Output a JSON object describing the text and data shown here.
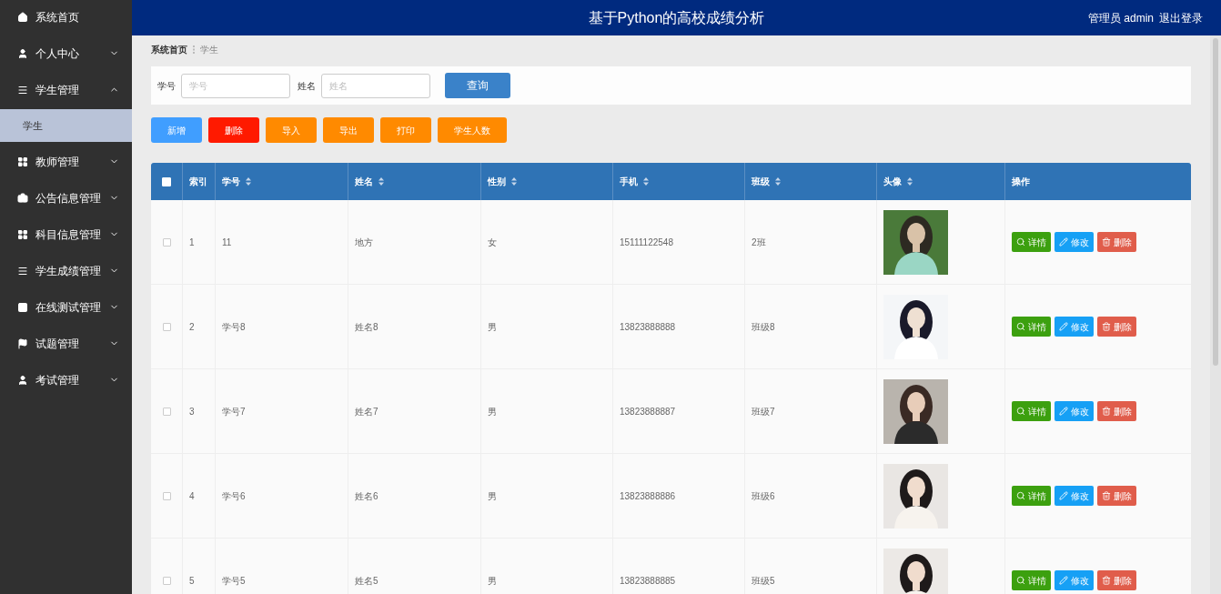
{
  "header": {
    "title": "基于Python的高校成绩分析",
    "user": "管理员 admin",
    "logout": "退出登录"
  },
  "sidebar": {
    "items": [
      {
        "label": "系统首页",
        "selected": false
      },
      {
        "label": "个人中心",
        "selected": false,
        "expanded": false
      },
      {
        "label": "学生管理",
        "selected": false,
        "expanded": true,
        "children": [
          {
            "label": "学生",
            "selected": true
          }
        ]
      },
      {
        "label": "教师管理",
        "selected": false,
        "expanded": false
      },
      {
        "label": "公告信息管理",
        "selected": false,
        "expanded": false
      },
      {
        "label": "科目信息管理",
        "selected": false,
        "expanded": false
      },
      {
        "label": "学生成绩管理",
        "selected": false,
        "expanded": false
      },
      {
        "label": "在线测试管理",
        "selected": false,
        "expanded": false
      },
      {
        "label": "试题管理",
        "selected": false,
        "expanded": false
      },
      {
        "label": "考试管理",
        "selected": false,
        "expanded": false
      }
    ]
  },
  "breadcrumb": [
    "系统首页",
    "学生"
  ],
  "search": {
    "fields": [
      {
        "label": "学号",
        "placeholder": "学号"
      },
      {
        "label": "姓名",
        "placeholder": "姓名"
      }
    ],
    "button": "查询"
  },
  "toolbar": [
    {
      "label": "新增",
      "kind": "primary"
    },
    {
      "label": "删除",
      "kind": "danger"
    },
    {
      "label": "导入",
      "kind": "warning"
    },
    {
      "label": "导出",
      "kind": "warning"
    },
    {
      "label": "打印",
      "kind": "warning"
    },
    {
      "label": "学生人数",
      "kind": "warning"
    }
  ],
  "table": {
    "select_all": {
      "checked": false
    },
    "columns": [
      {
        "label": "索引",
        "sortable": false
      },
      {
        "label": "学号",
        "sortable": true
      },
      {
        "label": "姓名",
        "sortable": true
      },
      {
        "label": "性别",
        "sortable": true
      },
      {
        "label": "手机",
        "sortable": true
      },
      {
        "label": "班级",
        "sortable": true
      },
      {
        "label": "头像",
        "sortable": true
      },
      {
        "label": "操作",
        "sortable": false
      }
    ],
    "rows": [
      {
        "checked": false,
        "cells": [
          "1",
          "11",
          "地方",
          "女",
          "15111122548",
          "2班"
        ],
        "actions": [
          {
            "label": "详情",
            "kind": "detail"
          },
          {
            "label": "修改",
            "kind": "edit"
          },
          {
            "label": "删除",
            "kind": "delete"
          }
        ]
      },
      {
        "checked": false,
        "cells": [
          "2",
          "学号8",
          "姓名8",
          "男",
          "13823888888",
          "班级8"
        ],
        "actions": [
          {
            "label": "详情",
            "kind": "detail"
          },
          {
            "label": "修改",
            "kind": "edit"
          },
          {
            "label": "删除",
            "kind": "delete"
          }
        ]
      },
      {
        "checked": false,
        "cells": [
          "3",
          "学号7",
          "姓名7",
          "男",
          "13823888887",
          "班级7"
        ],
        "actions": [
          {
            "label": "详情",
            "kind": "detail"
          },
          {
            "label": "修改",
            "kind": "edit"
          },
          {
            "label": "删除",
            "kind": "delete"
          }
        ]
      },
      {
        "checked": false,
        "cells": [
          "4",
          "学号6",
          "姓名6",
          "男",
          "13823888886",
          "班级6"
        ],
        "actions": [
          {
            "label": "详情",
            "kind": "detail"
          },
          {
            "label": "修改",
            "kind": "edit"
          },
          {
            "label": "删除",
            "kind": "delete"
          }
        ]
      },
      {
        "checked": false,
        "cells": [
          "5",
          "学号5",
          "姓名5",
          "男",
          "13823888885",
          "班级5"
        ],
        "actions": [
          {
            "label": "详情",
            "kind": "detail"
          },
          {
            "label": "修改",
            "kind": "edit"
          },
          {
            "label": "删除",
            "kind": "delete"
          }
        ]
      }
    ]
  }
}
